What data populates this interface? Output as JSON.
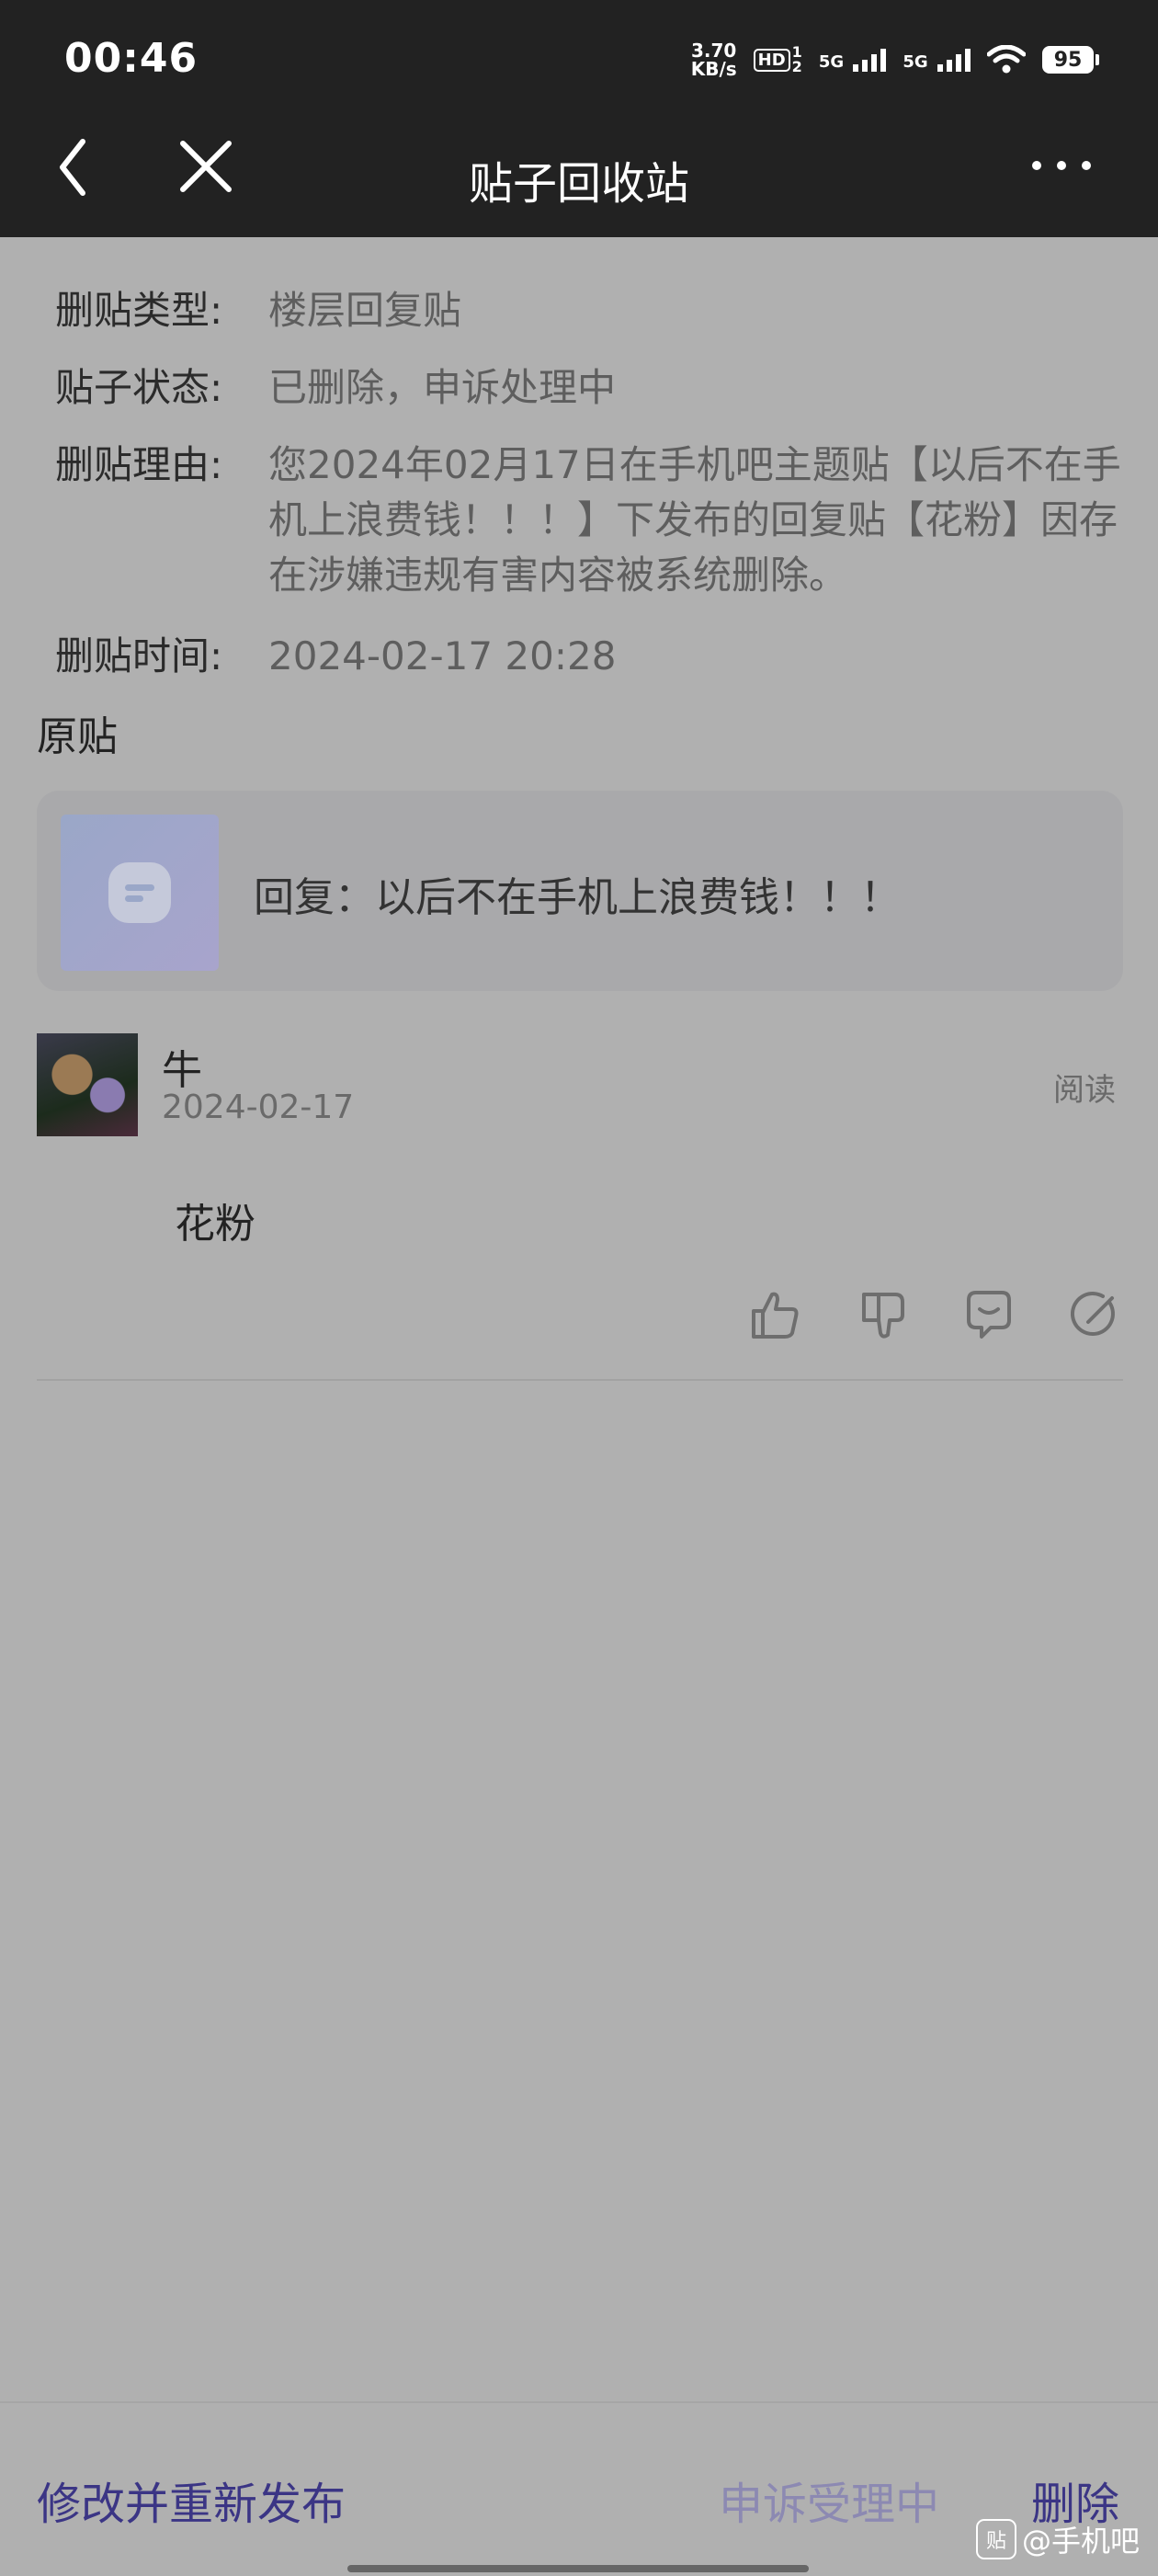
{
  "status_bar": {
    "time": "00:46",
    "net_speed_value": "3.70",
    "net_speed_unit": "KB/s",
    "hd_label": "HD",
    "hd_sub_top": "1",
    "hd_sub_bottom": "2",
    "signal1": "5G",
    "signal2": "5G",
    "battery": "95"
  },
  "nav": {
    "title": "贴子回收站"
  },
  "info": {
    "type_label": "删贴类型:",
    "type_value": "楼层回复贴",
    "status_label": "贴子状态:",
    "status_value": "已删除，申诉处理中",
    "reason_label": "删贴理由:",
    "reason_value": "您2024年02月17日在手机吧主题贴【以后不在手机上浪费钱！！！】下发布的回复贴【花粉】因存在涉嫌违规有害内容被系统删除。",
    "time_label": "删贴时间:",
    "time_value": "2024-02-17 20:28"
  },
  "original": {
    "section_title": "原贴",
    "card_text": "回复：以后不在手机上浪费钱！！！"
  },
  "reply": {
    "user_name": "牛",
    "date": "2024-02-17",
    "read_label": "阅读",
    "content": "花粉",
    "actions": [
      "thumbs-up-icon",
      "thumbs-down-icon",
      "comment-icon",
      "edit-icon"
    ]
  },
  "bottom": {
    "republish_label": "修改并重新发布",
    "appeal_label": "申诉受理中",
    "delete_label": "删除",
    "watermark_logo": "贴",
    "watermark_text": "@手机吧"
  },
  "colors": {
    "bar_bg": "#222222",
    "page_bg": "#b0b0b0",
    "accent": "#3b3585",
    "accent_disabled": "#8c89b2"
  }
}
